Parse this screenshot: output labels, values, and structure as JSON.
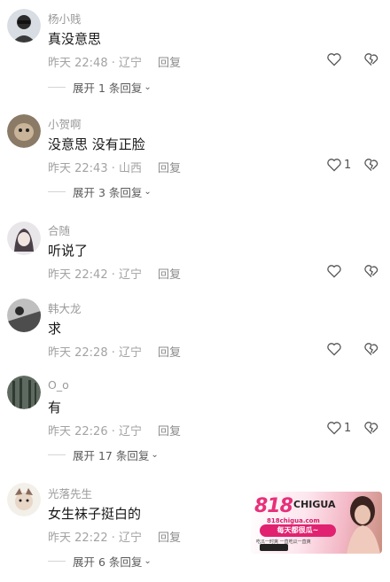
{
  "comments": [
    {
      "username": "杨小贱",
      "text": "真没意思",
      "time": "昨天 22:48 · 辽宁",
      "reply": "回复",
      "likes": "",
      "expand": "展开 1 条回复"
    },
    {
      "username": "小贺啊",
      "text": "没意思 没有正脸",
      "time": "昨天 22:43 · 山西",
      "reply": "回复",
      "likes": "1",
      "expand": "展开 3 条回复"
    },
    {
      "username": "合随",
      "text": "听说了",
      "time": "昨天 22:42 · 辽宁",
      "reply": "回复",
      "likes": "",
      "expand": ""
    },
    {
      "username": "韩大龙",
      "text": "求",
      "time": "昨天 22:28 · 辽宁",
      "reply": "回复",
      "likes": "",
      "expand": ""
    },
    {
      "username": "O_o",
      "text": "有",
      "time": "昨天 22:26 · 辽宁",
      "reply": "回复",
      "likes": "1",
      "expand": "展开 17 条回复"
    },
    {
      "username": "光落先生",
      "text": "女生袜子挺白的",
      "time": "昨天 22:22 · 辽宁",
      "reply": "回复",
      "likes": "",
      "expand": "展开 6 条回复"
    }
  ],
  "ad": {
    "logo_num": "818",
    "logo_text": "CHIGUA",
    "url": "818chigua.com",
    "banner": "每天都很瓜~",
    "sub": "吃瓜一时爽 一直吃瓜一直爽"
  },
  "colors": {
    "text": "#161616",
    "meta": "#a3a3a3",
    "username": "#9a9a9a",
    "accent": "#e02270"
  }
}
